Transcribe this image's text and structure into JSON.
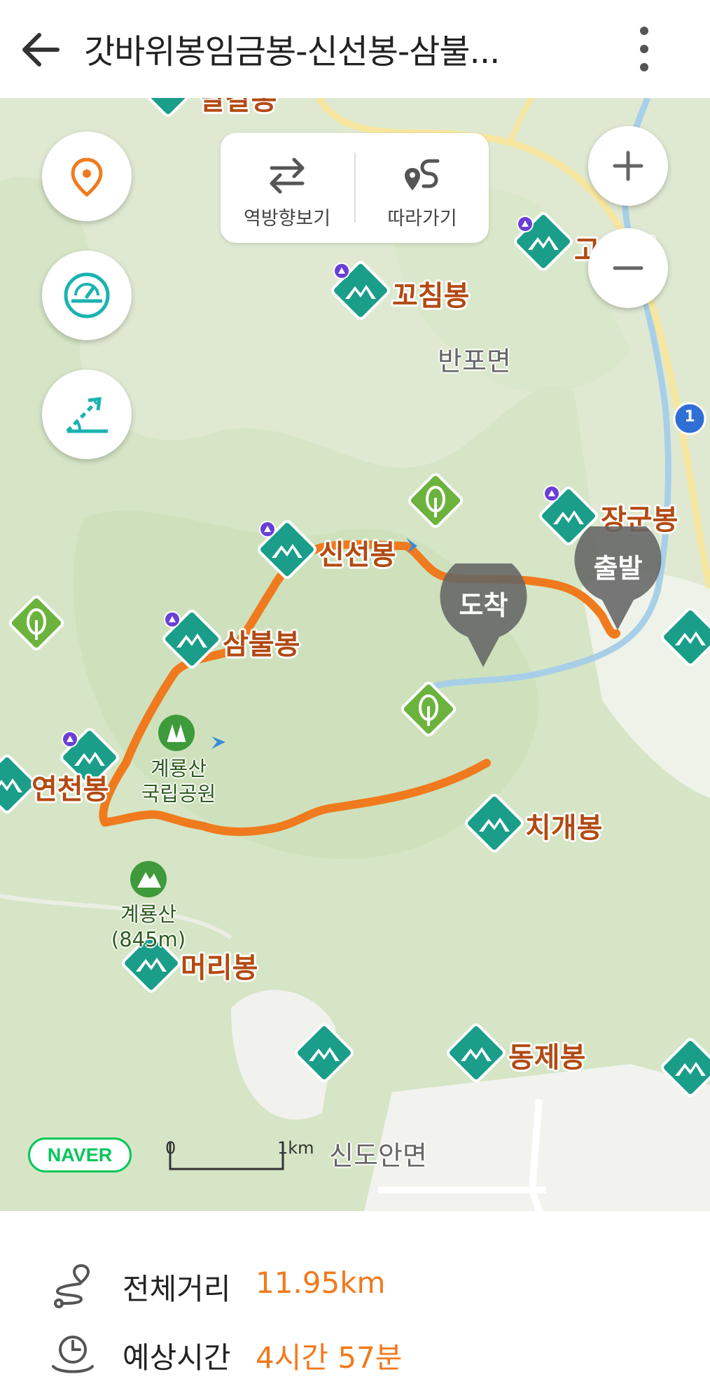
{
  "header": {
    "title": "갓바위봉임금봉-신선봉-삼불...",
    "back_icon": "back-arrow-icon",
    "more_icon": "more-vertical-icon"
  },
  "toolbar": {
    "reverse_label": "역방향보기",
    "follow_label": "따라가기"
  },
  "map": {
    "peaks": [
      "달걀봉",
      "고...봉",
      "꼬침봉",
      "장군봉",
      "신선봉",
      "삼불봉",
      "연천봉",
      "치개봉",
      "머리봉",
      "동제봉"
    ],
    "areas": [
      "반포면",
      "신도안면"
    ],
    "park": {
      "line1": "계룡산",
      "line2": "국립공원"
    },
    "mountain": {
      "line1": "계룡산",
      "line2": "(845m)"
    },
    "markers": {
      "start": "출발",
      "end": "도착"
    },
    "road_number": "1",
    "scale": {
      "zero": "0",
      "one": "1km"
    },
    "brand": "NAVER",
    "colors": {
      "route": "#f07a1e",
      "peak_icon": "#1a9e8a",
      "forest_icon": "#6cb33e",
      "brand": "#03c75a"
    }
  },
  "summary": {
    "distance_label": "전체거리",
    "distance_value": "11.95km",
    "time_label": "예상시간",
    "time_value": "4시간 57분"
  }
}
